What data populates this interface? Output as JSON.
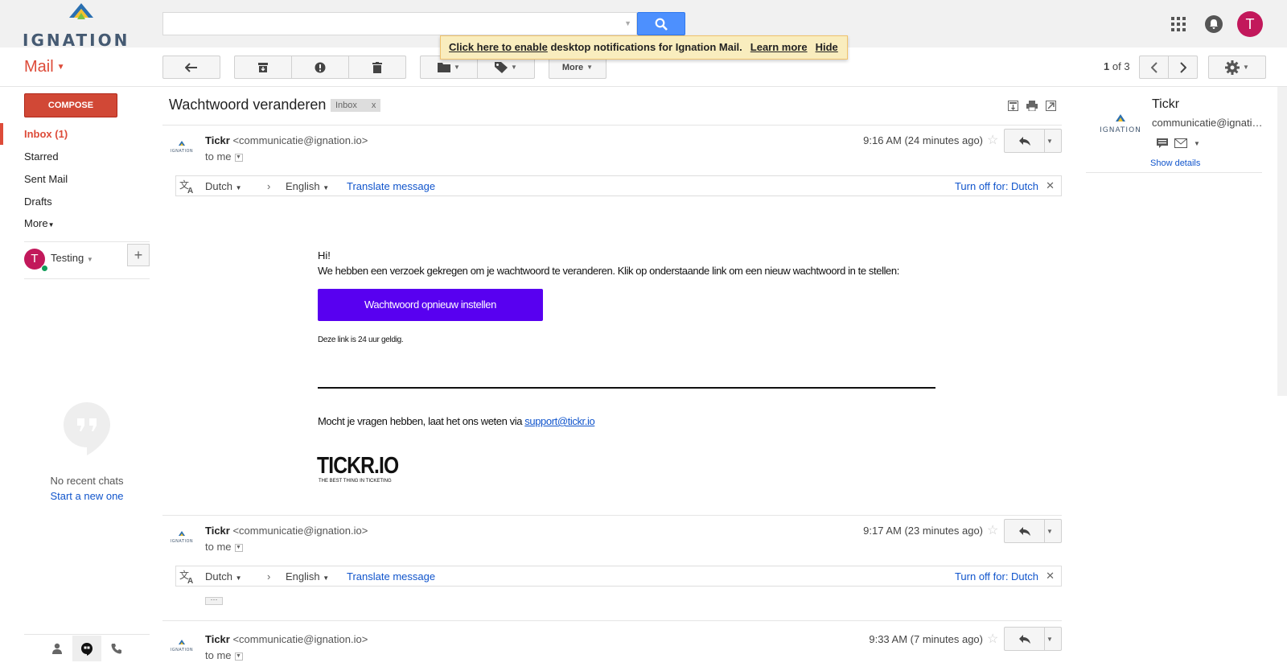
{
  "brand": {
    "name": "IGNATION"
  },
  "search": {
    "placeholder": ""
  },
  "notification": {
    "enable_link": "Click here to enable",
    "text": " desktop notifications for Ignation Mail.",
    "learn_more": "Learn more",
    "hide": "Hide"
  },
  "user": {
    "initial": "T"
  },
  "header": {
    "mail_label": "Mail"
  },
  "toolbar": {
    "more_label": "More"
  },
  "pager": {
    "current": "1",
    "of_text": "of 3"
  },
  "sidebar": {
    "compose": "COMPOSE",
    "items": [
      {
        "label": "Inbox (1)"
      },
      {
        "label": "Starred"
      },
      {
        "label": "Sent Mail"
      },
      {
        "label": "Drafts"
      },
      {
        "label": "More"
      }
    ],
    "account_name": "Testing",
    "no_chats": "No recent chats",
    "start_new": "Start a new one"
  },
  "thread": {
    "subject": "Wachtwoord veranderen",
    "label": "Inbox",
    "label_close": "x"
  },
  "messages": [
    {
      "sender": "Tickr",
      "email": "<communicatie@ignation.io>",
      "to": "to me",
      "time": "9:16 AM (24 minutes ago)"
    },
    {
      "sender": "Tickr",
      "email": "<communicatie@ignation.io>",
      "to": "to me",
      "time": "9:17 AM (23 minutes ago)"
    },
    {
      "sender": "Tickr",
      "email": "<communicatie@ignation.io>",
      "to": "to me",
      "time": "9:33 AM (7 minutes ago)"
    }
  ],
  "translate": {
    "source": "Dutch",
    "target": "English",
    "translate_message": "Translate message",
    "turn_off": "Turn off for: Dutch"
  },
  "email_body": {
    "greeting": "Hi!",
    "paragraph": "We hebben een verzoek gekregen om je wachtwoord te veranderen. Klik op onderstaande link om een nieuw wachtwoord in te stellen:",
    "button": "Wachtwoord opnieuw instellen",
    "validity": "Deze link is 24 uur geldig.",
    "question": "Mocht je vragen hebben, laat het ons weten via ",
    "support_link": "support@tickr.io",
    "brand": "TICKR.IO",
    "tagline": "THE BEST THING IN TICKETING"
  },
  "contact_panel": {
    "name": "Tickr",
    "email": "communicatie@ignation.io",
    "show_details": "Show details"
  },
  "colors": {
    "compose": "#d14836",
    "accent_red": "#dd4b39",
    "cta": "#5800f0",
    "search_btn": "#4d90fe",
    "avatar": "#c2185b"
  }
}
